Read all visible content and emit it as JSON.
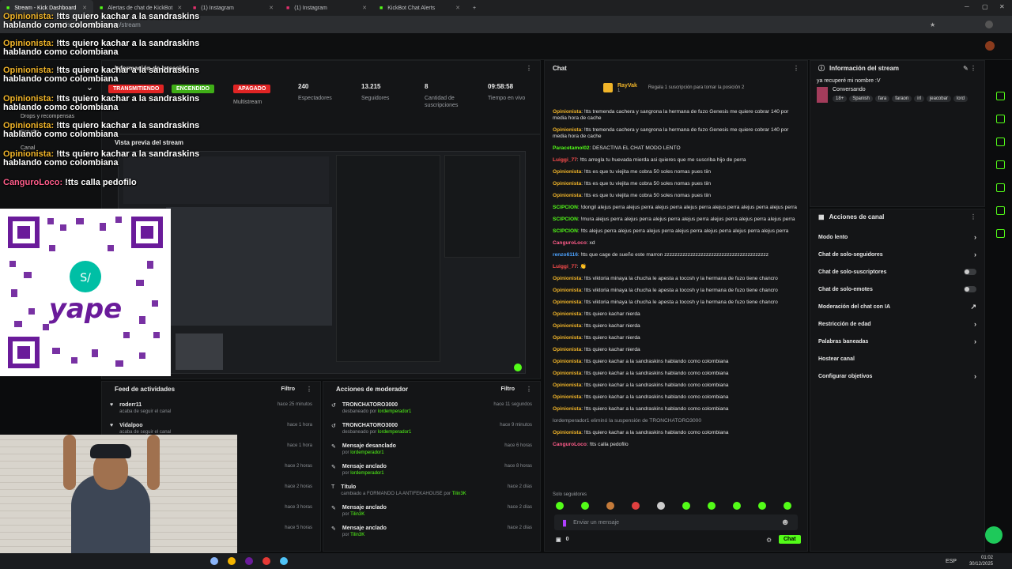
{
  "browser": {
    "tabs": [
      {
        "label": "Stream - Kick Dashboard",
        "active": true
      },
      {
        "label": "Alertas de chat de KickBot",
        "active": false
      },
      {
        "label": "(1) Instagram",
        "active": false
      },
      {
        "label": "(1) Instagram",
        "active": false
      },
      {
        "label": "KickBot Chat Alerts",
        "active": false
      }
    ],
    "url": "dashboard.kick.com/stream"
  },
  "overlay_chat": [
    {
      "user": "Opinionista:",
      "msg": " !tts quiero kachar a la sandraskins hablando como colombiana"
    },
    {
      "user": "Opinionista:",
      "msg": " !tts quiero kachar a la sandraskins hablando como colombiana"
    },
    {
      "user": "Opinionista:",
      "msg": " !tts quiero kachar a la sandraskins hablando como colombiana"
    },
    {
      "user": "Opinionista:",
      "msg": " !tts quiero kachar a la sandraskins hablando como colombiana"
    },
    {
      "user": "Opinionista:",
      "msg": " !tts quiero kachar a la sandraskins hablando como colombiana"
    },
    {
      "user": "Opinionista:",
      "msg": " !tts quiero kachar a la sandraskins hablando como colombiana"
    },
    {
      "user": "CanguroLoco:",
      "msg": " !tts calla pedofilo"
    }
  ],
  "left_nav": {
    "drops": "Drops y recompensas",
    "estudio": "Estudio",
    "canal": "Canal"
  },
  "session": {
    "title": "Información de la sesión",
    "badges": {
      "live": "TRANSMITIENDO",
      "on": "ENCENDIDO",
      "off": "APAGADO",
      "multi": "Multistream"
    },
    "stats": [
      {
        "value": "240",
        "label": "Espectadores"
      },
      {
        "value": "13.215",
        "label": "Seguidores"
      },
      {
        "value": "8",
        "label": "Cantidad de suscripciones"
      },
      {
        "value": "09:58:58",
        "label": "Tiempo en vivo"
      }
    ]
  },
  "preview": {
    "title": "Vista previa del stream"
  },
  "feed": {
    "title": "Feed de actividades",
    "filter": "Filtro",
    "items": [
      {
        "name": "roderr11",
        "sub": "acaba de seguir el canal",
        "time": "hace 25 minutos"
      },
      {
        "name": "Vidalpoo",
        "sub": "acaba de seguir el canal",
        "time": "hace 1 hora"
      },
      {
        "name": "",
        "sub": "",
        "time": "hace 1 hora"
      },
      {
        "name": "",
        "sub": "",
        "time": "hace 2 horas"
      },
      {
        "name": "",
        "sub": "",
        "time": "hace 2 horas"
      },
      {
        "name": "",
        "sub": "",
        "time": "hace 3 horas"
      },
      {
        "name": "",
        "sub": "",
        "time": "hace 5 horas"
      }
    ]
  },
  "modactions": {
    "title": "Acciones de moderador",
    "filter": "Filtro",
    "items": [
      {
        "name": "TRONCHATORO3000",
        "sub": "desbaneado por ",
        "who": "lordemperador1",
        "time": "hace 11 segundos"
      },
      {
        "name": "TRONCHATORO3000",
        "sub": "desbaneado por ",
        "who": "lordemperador1",
        "time": "hace 9 minutos"
      },
      {
        "name": "Mensaje desanclado",
        "sub": "por ",
        "who": "lordemperador1",
        "time": "hace 6 horas"
      },
      {
        "name": "Mensaje anclado",
        "sub": "por ",
        "who": "lordemperador1",
        "time": "hace 8 horas"
      },
      {
        "name": "Título",
        "sub": "cambiado a FORMANDO LA ANTIFEKAHOUSE por ",
        "who": "Tilin3K",
        "time": "hace 2 días"
      },
      {
        "name": "Mensaje anclado",
        "sub": "por ",
        "who": "Tilin3K",
        "time": "hace 2 días"
      },
      {
        "name": "Mensaje anclado",
        "sub": "por ",
        "who": "Tilin3K",
        "time": "hace 2 días"
      }
    ]
  },
  "chat": {
    "title": "Chat",
    "top_gifter": "RayVak",
    "top_gifter_count": "1",
    "gift_text": "Regala 1 suscripción para tomar la posición 2",
    "messages": [
      {
        "user": "Opinionista",
        "color": "#f0b429",
        "msg": ": !tts tremenda cachera y sangrona la hermana de fuzo Genesis me quiere cobrar 140 por media hora de cache"
      },
      {
        "user": "Opinionista",
        "color": "#f0b429",
        "msg": ": !tts tremenda cachera y sangrona la hermana de fuzo Genesis me quiere cobrar 140 por media hora de cache"
      },
      {
        "user": "Paracetamol02",
        "color": "#53fc18",
        "msg": ": DESACTIVA EL CHAT MODO LENTO"
      },
      {
        "user": "Luiggi_77",
        "color": "#ff4d4d",
        "msg": ": !tts arregla tu huevada mierda asi quieres que me suscriba hijo de perra"
      },
      {
        "user": "Opinionista",
        "color": "#f0b429",
        "msg": ": !tts es que tu viejita me cobra 50 soles nomas pues tiin"
      },
      {
        "user": "Opinionista",
        "color": "#f0b429",
        "msg": ": !tts es que tu viejita me cobra 50 soles nomas pues tiin"
      },
      {
        "user": "Opinionista",
        "color": "#f0b429",
        "msg": ": !tts es que tu viejita me cobra 50 soles nomas pues tiin"
      },
      {
        "user": "SCIPCION",
        "color": "#53fc18",
        "msg": ": !dongil alejus perra alejus perra alejus perra alejus perra alejus perra alejus perra alejus perra"
      },
      {
        "user": "SCIPCION",
        "color": "#53fc18",
        "msg": ": !mura alejus perra alejus perra alejus perra alejus perra alejus perra alejus perra alejus perra"
      },
      {
        "user": "SCIPCION",
        "color": "#53fc18",
        "msg": ": !tts alejus perra alejus perra alejus perra alejus perra alejus perra alejus perra alejus perra"
      },
      {
        "user": "CanguroLoco",
        "color": "#ff5c8a",
        "msg": ": xd"
      },
      {
        "user": "renzo6116",
        "color": "#4da3ff",
        "msg": ": !tts que cage de sueño este marron zzzzzzzzzzzzzzzzzzzzzzzzzzzzzzzzzzzzzzzz"
      },
      {
        "user": "Luiggi_77",
        "color": "#ff4d4d",
        "msg": ": 👏"
      },
      {
        "user": "Opinionista",
        "color": "#f0b429",
        "msg": ": !tts viktoria minaya la chucha le apesta a tocosh y la hermana de fuzo tiene chancro"
      },
      {
        "user": "Opinionista",
        "color": "#f0b429",
        "msg": ": !tts viktoria minaya la chucha le apesta a tocosh y la hermana de fuzo tiene chancro"
      },
      {
        "user": "Opinionista",
        "color": "#f0b429",
        "msg": ": !tts viktoria minaya la chucha le apesta a tocosh y la hermana de fuzo tiene chancro"
      },
      {
        "user": "Opinionista",
        "color": "#f0b429",
        "msg": ": !tts quiero kachar nierda"
      },
      {
        "user": "Opinionista",
        "color": "#f0b429",
        "msg": ": !tts quiero kachar nierda"
      },
      {
        "user": "Opinionista",
        "color": "#f0b429",
        "msg": ": !tts quiero kachar nierda"
      },
      {
        "user": "Opinionista",
        "color": "#f0b429",
        "msg": ": !tts quiero kachar nierda"
      },
      {
        "user": "Opinionista",
        "color": "#f0b429",
        "msg": ": !tts quiero kachar a la sandraskins hablando como colombiana"
      },
      {
        "user": "Opinionista",
        "color": "#f0b429",
        "msg": ": !tts quiero kachar a la sandraskins hablando como colombiana"
      },
      {
        "user": "Opinionista",
        "color": "#f0b429",
        "msg": ": !tts quiero kachar a la sandraskins hablando como colombiana"
      },
      {
        "user": "Opinionista",
        "color": "#f0b429",
        "msg": ": !tts quiero kachar a la sandraskins hablando como colombiana"
      },
      {
        "user": "Opinionista",
        "color": "#f0b429",
        "msg": ": !tts quiero kachar a la sandraskins hablando como colombiana"
      },
      {
        "user": "",
        "color": "#9a9ea3",
        "msg": "lordemperador1 eliminó la suspensión de TRONCHATORO3000"
      },
      {
        "user": "Opinionista",
        "color": "#f0b429",
        "msg": ": !tts quiero kachar a la sandraskins hablando como colombiana"
      },
      {
        "user": "CanguroLoco",
        "color": "#ff5c8a",
        "msg": ": !tts calla pedofilo"
      }
    ],
    "followers_only": "Solo seguidores",
    "input_placeholder": "Enviar un mensaje",
    "count": "0",
    "send_label": "Chat"
  },
  "stream_info": {
    "title": "Información del stream",
    "stream_title": "ya recuperé mi nombre :V",
    "category": "Conversando",
    "tags": [
      "18+",
      "Spanish",
      "fara",
      "faraon",
      "irl",
      "jeacobar",
      "lord"
    ]
  },
  "channel_actions": {
    "title": "Acciones de canal",
    "items": [
      {
        "label": "Modo lento",
        "type": "chevron"
      },
      {
        "label": "Chat de solo-seguidores",
        "type": "chevron"
      },
      {
        "label": "Chat de solo-suscriptores",
        "type": "toggle"
      },
      {
        "label": "Chat de solo-emotes",
        "type": "toggle"
      },
      {
        "label": "Moderación del chat con IA",
        "type": "link"
      },
      {
        "label": "Restricción de edad",
        "type": "chevron"
      },
      {
        "label": "Palabras baneadas",
        "type": "chevron"
      },
      {
        "label": "Hostear canal",
        "type": "none"
      },
      {
        "label": "Configurar objetivos",
        "type": "chevron"
      }
    ]
  },
  "taskbar": {
    "lang": "ESP",
    "time": "01:02",
    "date": "30/12/2025"
  },
  "colors": {
    "kick_green": "#53fc18",
    "live_red": "#e02424",
    "panel": "#141517"
  }
}
